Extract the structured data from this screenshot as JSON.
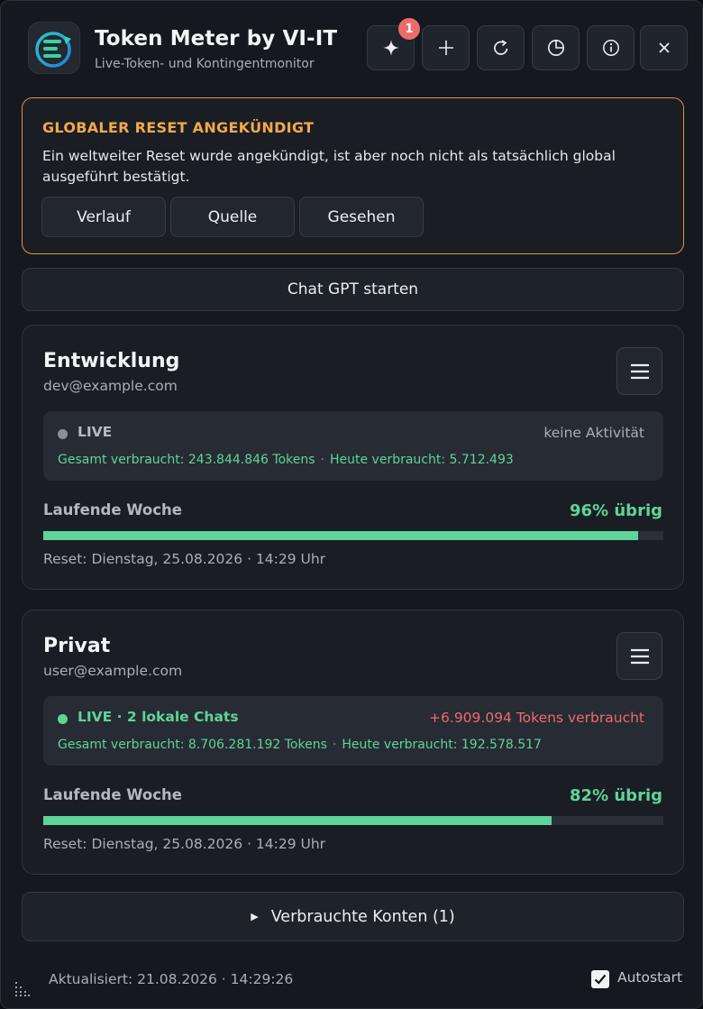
{
  "app": {
    "title": "Token Meter by VI-IT",
    "subtitle": "Live-Token- und Kontingentmonitor",
    "logo_icon": "token-meter-logo-icon"
  },
  "toolbar": {
    "buttons": [
      {
        "name": "sparkle-button",
        "icon": "sparkle-icon",
        "badge": "1"
      },
      {
        "name": "add-button",
        "icon": "plus-icon"
      },
      {
        "name": "refresh-button",
        "icon": "refresh-icon"
      },
      {
        "name": "history-button",
        "icon": "pie-clock-icon"
      },
      {
        "name": "info-button",
        "icon": "info-icon"
      },
      {
        "name": "close-button",
        "icon": "close-icon"
      }
    ]
  },
  "announcement": {
    "title": "GLOBALER RESET ANGEKÜNDIGT",
    "text": "Ein weltweiter Reset wurde angekündigt, ist aber noch nicht als tatsächlich global ausgeführt bestätigt.",
    "buttons": {
      "history": "Verlauf",
      "source": "Quelle",
      "seen": "Gesehen"
    },
    "border_color": "#d59a3f",
    "title_color": "#f0a94c"
  },
  "start_button": "Chat GPT starten",
  "accounts": [
    {
      "name": "Entwicklung",
      "email": "dev@example.com",
      "live": {
        "label": "LIVE",
        "dot_color": "#8b8f98",
        "label_color": "#b6bac3",
        "right_text": "keine Aktivität",
        "right_color": "#a9afb9",
        "total": "Gesamt verbraucht: 243.844.846 Tokens",
        "today": "Heute verbraucht: 5.712.493"
      },
      "week_label": "Laufende Woche",
      "remaining": "96% übrig",
      "remaining_pct": 96,
      "reset": "Reset: Dienstag, 25.08.2026 · 14:29 Uhr"
    },
    {
      "name": "Privat",
      "email": "user@example.com",
      "live": {
        "label": "LIVE · 2 lokale Chats",
        "dot_color": "#5fd49a",
        "label_color": "#5fd49a",
        "right_text": "+6.909.094 Tokens verbraucht",
        "right_color": "#ee6b6b",
        "total": "Gesamt verbraucht: 8.706.281.192 Tokens",
        "today": "Heute verbraucht: 192.578.517"
      },
      "week_label": "Laufende Woche",
      "remaining": "82% übrig",
      "remaining_pct": 82,
      "reset": "Reset: Dienstag, 25.08.2026 · 14:29 Uhr"
    }
  ],
  "used_accounts": {
    "label": "Verbrauchte Konten (1)",
    "icon": "triangle-right-icon"
  },
  "footer": {
    "updated": "Aktualisiert: 21.08.2026 · 14:29:26",
    "autostart_label": "Autostart",
    "autostart_checked": true
  },
  "colors": {
    "accent_green": "#5fd49a",
    "alert_red": "#ee6b6b",
    "warning_orange": "#f0a94c"
  }
}
